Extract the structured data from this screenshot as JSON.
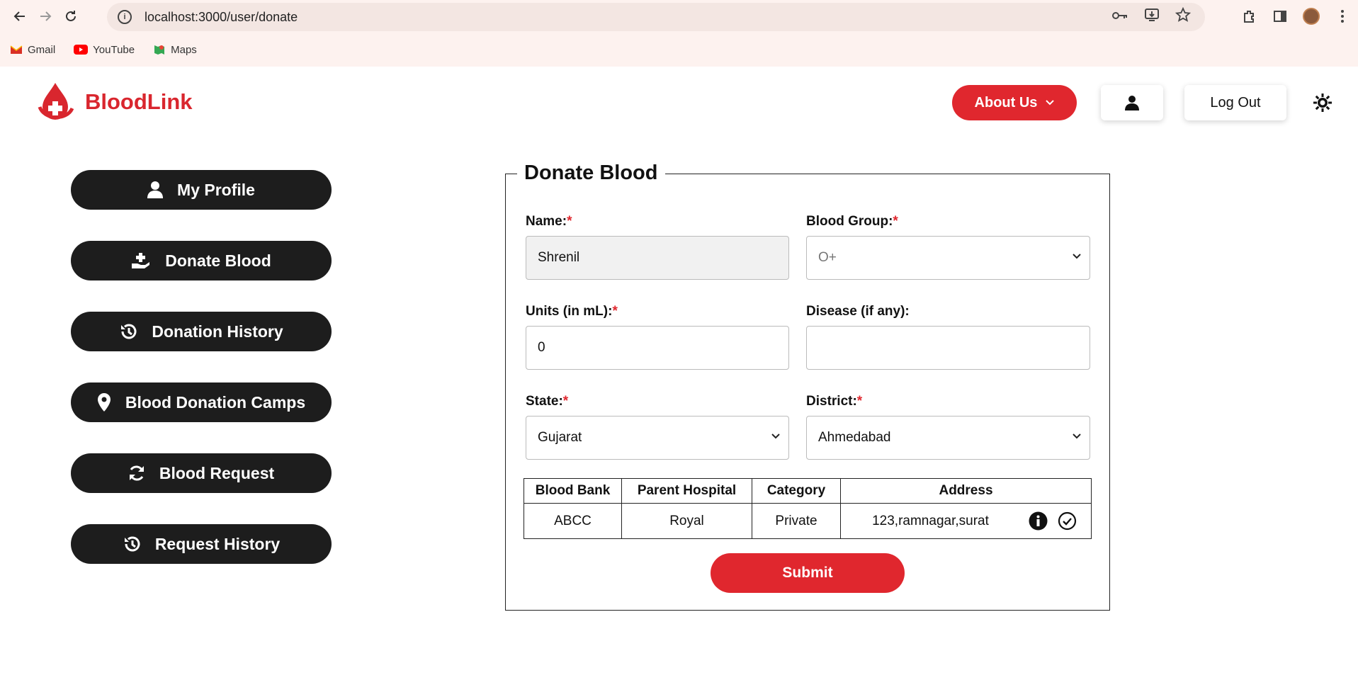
{
  "browser": {
    "url": "localhost:3000/user/donate",
    "bookmarks": [
      {
        "label": "Gmail",
        "color": "#d93025"
      },
      {
        "label": "YouTube",
        "color": "#ff0000"
      },
      {
        "label": "Maps",
        "color": "#34a853"
      }
    ]
  },
  "header": {
    "brand": "BloodLink",
    "about_label": "About Us",
    "logout_label": "Log Out"
  },
  "sidebar": {
    "items": [
      {
        "label": "My Profile",
        "icon": "user-icon"
      },
      {
        "label": "Donate Blood",
        "icon": "hand-plus-icon"
      },
      {
        "label": "Donation History",
        "icon": "history-icon"
      },
      {
        "label": "Blood Donation Camps",
        "icon": "map-pin-icon"
      },
      {
        "label": "Blood Request",
        "icon": "refresh-icon"
      },
      {
        "label": "Request History",
        "icon": "history-icon"
      }
    ]
  },
  "form": {
    "title": "Donate Blood",
    "name_label": "Name:",
    "name_value": "Shrenil",
    "blood_group_label": "Blood Group:",
    "blood_group_value": "O+",
    "units_label": "Units (in mL):",
    "units_value": "0",
    "disease_label": "Disease (if any):",
    "disease_value": "",
    "state_label": "State:",
    "state_value": "Gujarat",
    "district_label": "District:",
    "district_value": "Ahmedabad",
    "required_mark": "*",
    "submit_label": "Submit"
  },
  "table": {
    "headers": [
      "Blood Bank",
      "Parent Hospital",
      "Category",
      "Address"
    ],
    "rows": [
      {
        "bank": "ABCC",
        "hospital": "Royal",
        "category": "Private",
        "address": "123,ramnagar,surat"
      }
    ]
  },
  "colors": {
    "brand_red": "#e0272e",
    "dark": "#1d1d1d"
  }
}
